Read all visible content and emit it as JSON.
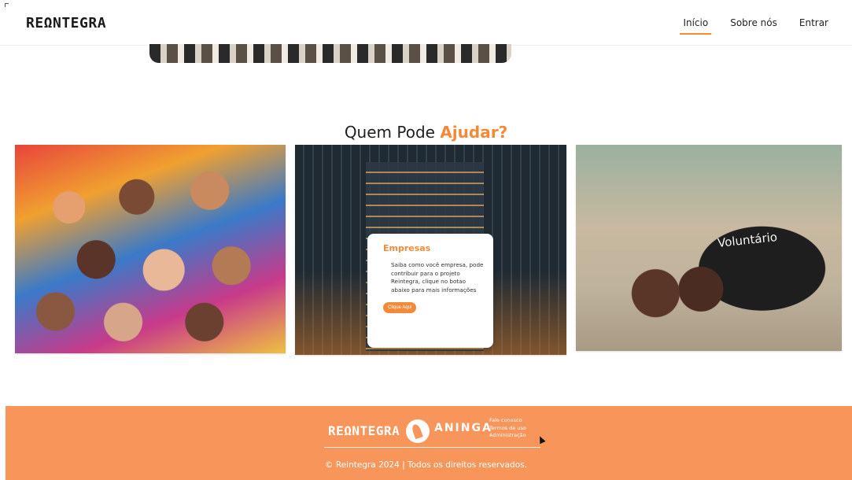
{
  "header": {
    "logo": "REΩNTEGRA",
    "nav": [
      "Início",
      "Sobre nós",
      "Entrar"
    ]
  },
  "section": {
    "title_prefix": "Quem Pode",
    "title_accent": "Ajudar?"
  },
  "cards": {
    "volunteer_shirt_text": "Voluntário"
  },
  "info_box": {
    "title": "Empresas",
    "text": "Saiba como você empresa, pode contribuir para o projeto Reintegra, clique no botao abaixo para mais informações",
    "button": "Clique Aqui"
  },
  "footer": {
    "logo": "REΩNTEGRA",
    "partner": "ANINGA",
    "links": [
      "Fale conosco",
      "Termos de uso",
      "Administração"
    ],
    "copyright": "© Reintegra 2024 | Todos os direitos reservados."
  },
  "colors": {
    "accent": "#f28a3a",
    "footer_bg": "#f7955a"
  }
}
